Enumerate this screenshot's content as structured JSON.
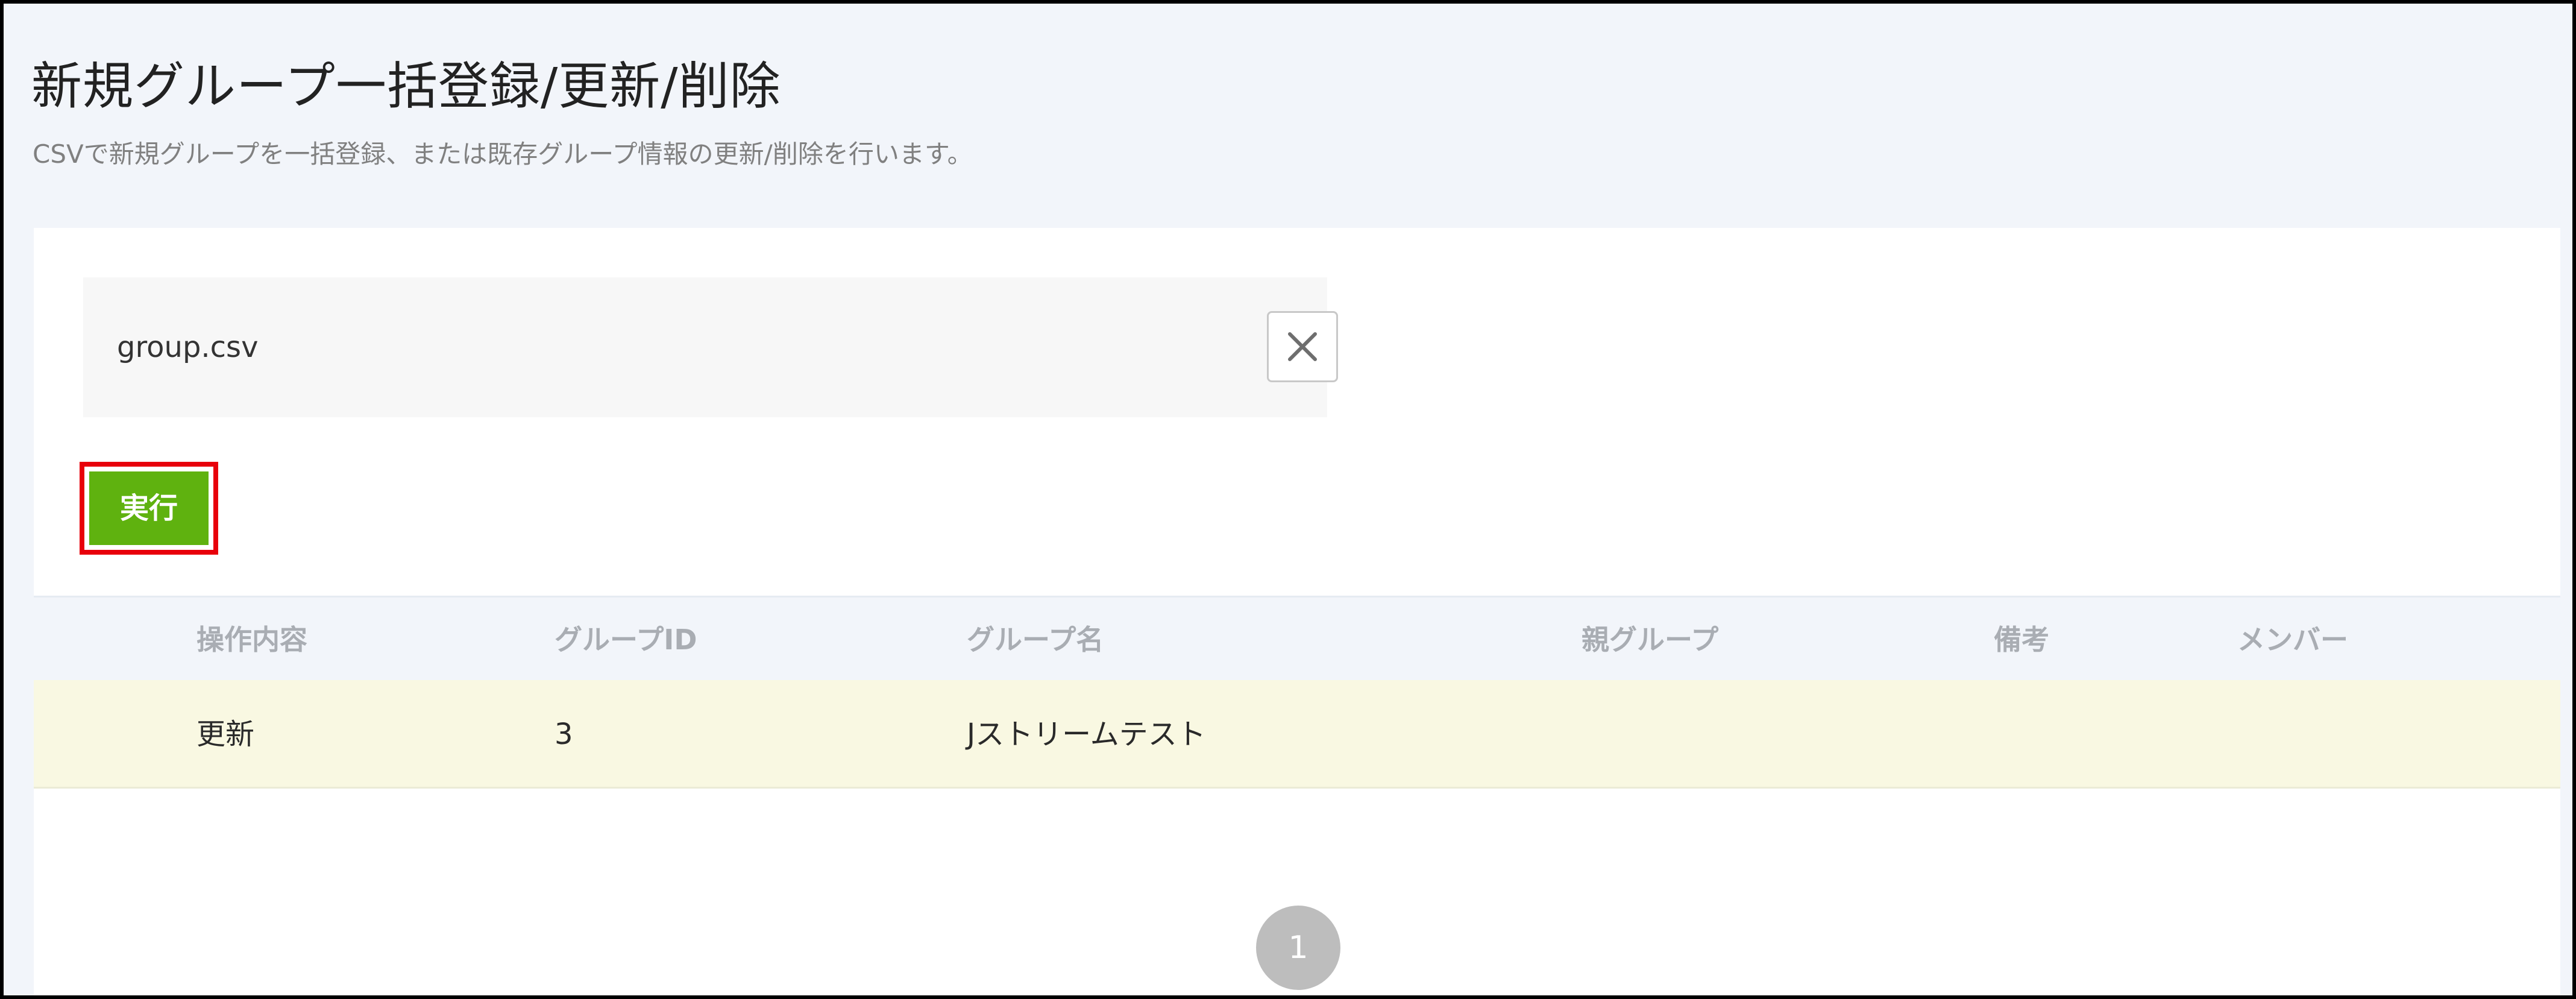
{
  "header": {
    "title": "新規グループ一括登録/更新/削除",
    "description": "CSVで新規グループを一括登録、または既存グループ情報の更新/削除を行います。"
  },
  "upload": {
    "file_name": "group.csv",
    "clear_icon": "close-icon"
  },
  "actions": {
    "run_label": "実行",
    "highlight_color": "#e8000b",
    "button_color": "#5fb20f"
  },
  "table": {
    "columns": [
      "操作内容",
      "グループID",
      "グループ名",
      "親グループ",
      "備考",
      "メンバー"
    ],
    "rows": [
      {
        "operation": "更新",
        "group_id": "3",
        "group_name": "Jストリームテスト",
        "parent_group": "",
        "note": "",
        "members": ""
      }
    ],
    "row_background": "#f9f8e2"
  },
  "pagination": {
    "current_page": "1"
  }
}
